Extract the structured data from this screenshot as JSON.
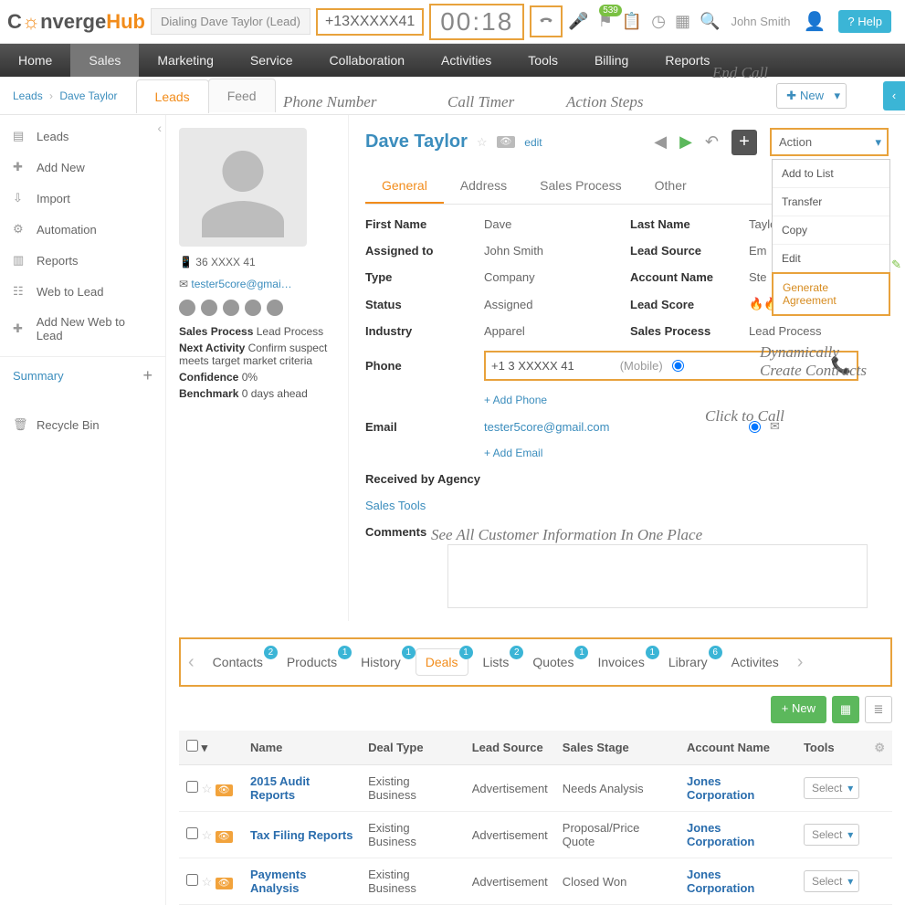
{
  "logo": {
    "pre": "C",
    "mid": "☼",
    "post": "nverge",
    "suffix": "Hub"
  },
  "topbar": {
    "dialing": "Dialing Dave Taylor (Lead)",
    "phone": "+13XXXXX41",
    "timer": "00:18",
    "badge": "539",
    "user": "John Smith",
    "help": "? Help"
  },
  "mainnav": [
    "Home",
    "Sales",
    "Marketing",
    "Service",
    "Collaboration",
    "Activities",
    "Tools",
    "Billing",
    "Reports"
  ],
  "breadcrumb": {
    "root": "Leads",
    "leaf": "Dave Taylor"
  },
  "subtabs": {
    "leads": "Leads",
    "feed": "Feed"
  },
  "new_dd": "New",
  "sidebar": {
    "items": [
      "Leads",
      "Add New",
      "Import",
      "Automation",
      "Reports",
      "Web to Lead",
      "Add New Web to Lead"
    ],
    "summary": "Summary",
    "recycle": "Recycle Bin"
  },
  "leftcol": {
    "phone": "36 XXXX 41",
    "email": "tester5core@gmai…",
    "lines": [
      {
        "label": "Sales Process",
        "val": "Lead Process"
      },
      {
        "label": "Next Activity",
        "val": "Confirm suspect meets target market criteria"
      },
      {
        "label": "Confidence",
        "val": "0%"
      },
      {
        "label": "Benchmark",
        "val": "0 days ahead"
      }
    ]
  },
  "lead": {
    "name": "Dave Taylor",
    "edit": "edit",
    "action_label": "Action",
    "action_items": [
      "Add to List",
      "Transfer",
      "Copy",
      "Edit"
    ],
    "action_gen": "Generate Agreement"
  },
  "dtabs": [
    "General",
    "Address",
    "Sales Process",
    "Other"
  ],
  "fields": {
    "first_name": {
      "l": "First Name",
      "v": "Dave"
    },
    "last_name": {
      "l": "Last Name",
      "v": "Taylor"
    },
    "assigned": {
      "l": "Assigned to",
      "v": "John Smith"
    },
    "lead_source": {
      "l": "Lead Source",
      "v": "Em"
    },
    "type": {
      "l": "Type",
      "v": "Company"
    },
    "account": {
      "l": "Account Name",
      "v": "Ste"
    },
    "status": {
      "l": "Status",
      "v": "Assigned"
    },
    "score": {
      "l": "Lead Score",
      "v": ""
    },
    "industry": {
      "l": "Industry",
      "v": "Apparel"
    },
    "process": {
      "l": "Sales Process",
      "v": "Lead Process"
    },
    "phone": {
      "l": "Phone",
      "v": "+1 3 XXXXX 41",
      "type": "(Mobile)",
      "add": "+ Add Phone"
    },
    "email": {
      "l": "Email",
      "v": "tester5core@gmail.com",
      "add": "+ Add Email"
    },
    "agency": {
      "l": "Received by Agency",
      "v": "Sales Tools"
    },
    "comments": {
      "l": "Comments"
    }
  },
  "reltabs": [
    {
      "label": "Contacts",
      "n": "2"
    },
    {
      "label": "Products",
      "n": "1"
    },
    {
      "label": "History",
      "n": "1"
    },
    {
      "label": "Deals",
      "n": "1"
    },
    {
      "label": "Lists",
      "n": "2"
    },
    {
      "label": "Quotes",
      "n": "1"
    },
    {
      "label": "Invoices",
      "n": "1"
    },
    {
      "label": "Library",
      "n": "6"
    },
    {
      "label": "Activites",
      "n": ""
    }
  ],
  "deals": {
    "new": "+ New",
    "cols": [
      "Name",
      "Deal Type",
      "Lead Source",
      "Sales Stage",
      "Account Name",
      "Tools"
    ],
    "rows": [
      {
        "name": "2015 Audit Reports",
        "type": "Existing Business",
        "src": "Advertisement",
        "stage": "Needs Analysis",
        "acct": "Jones Corporation",
        "tool": "Select"
      },
      {
        "name": "Tax Filing Reports",
        "type": "Existing Business",
        "src": "Advertisement",
        "stage": "Proposal/Price Quote",
        "acct": "Jones Corporation",
        "tool": "Select"
      },
      {
        "name": "Payments Analysis",
        "type": "Existing Business",
        "src": "Advertisement",
        "stage": "Closed Won",
        "acct": "Jones Corporation",
        "tool": "Select"
      }
    ]
  },
  "annots": {
    "phone": "Phone Number",
    "timer": "Call Timer",
    "steps": "Action Steps",
    "end": "End Call",
    "dyn": "Dynamically\nCreate Contracts",
    "ctc": "Click to Call",
    "allinfo": "See All Customer Information In One Place"
  }
}
